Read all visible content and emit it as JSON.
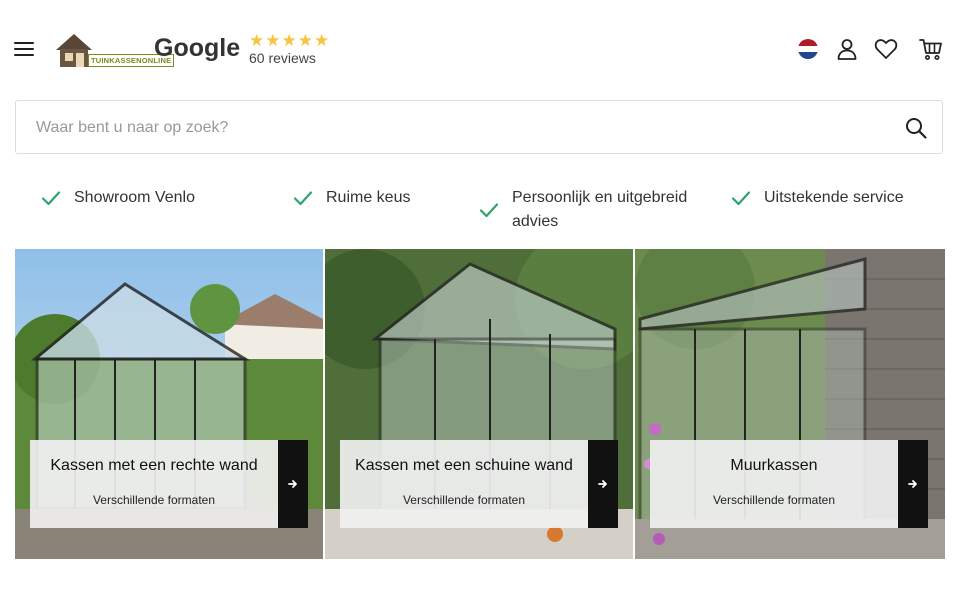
{
  "header": {
    "logo_text": "TUINKASSENONLINE",
    "rating_source": "Google",
    "stars": "★★★★★",
    "reviews": "60 reviews"
  },
  "search": {
    "placeholder": "Waar bent u naar op zoek?"
  },
  "usps": [
    {
      "label": "Showroom Venlo"
    },
    {
      "label": "Ruime keus"
    },
    {
      "label": "Persoonlijk en uitgebreid advies"
    },
    {
      "label": "Uitstekende service"
    }
  ],
  "categories": [
    {
      "title": "Kassen met een rechte wand",
      "subtitle": "Verschillende formaten"
    },
    {
      "title": "Kassen met een schuine wand",
      "subtitle": "Verschillende formaten"
    },
    {
      "title": "Muurkassen",
      "subtitle": "Verschillende formaten"
    }
  ],
  "colors": {
    "accent_check": "#2fa36b",
    "star": "#f5c542",
    "dark": "#111111"
  }
}
